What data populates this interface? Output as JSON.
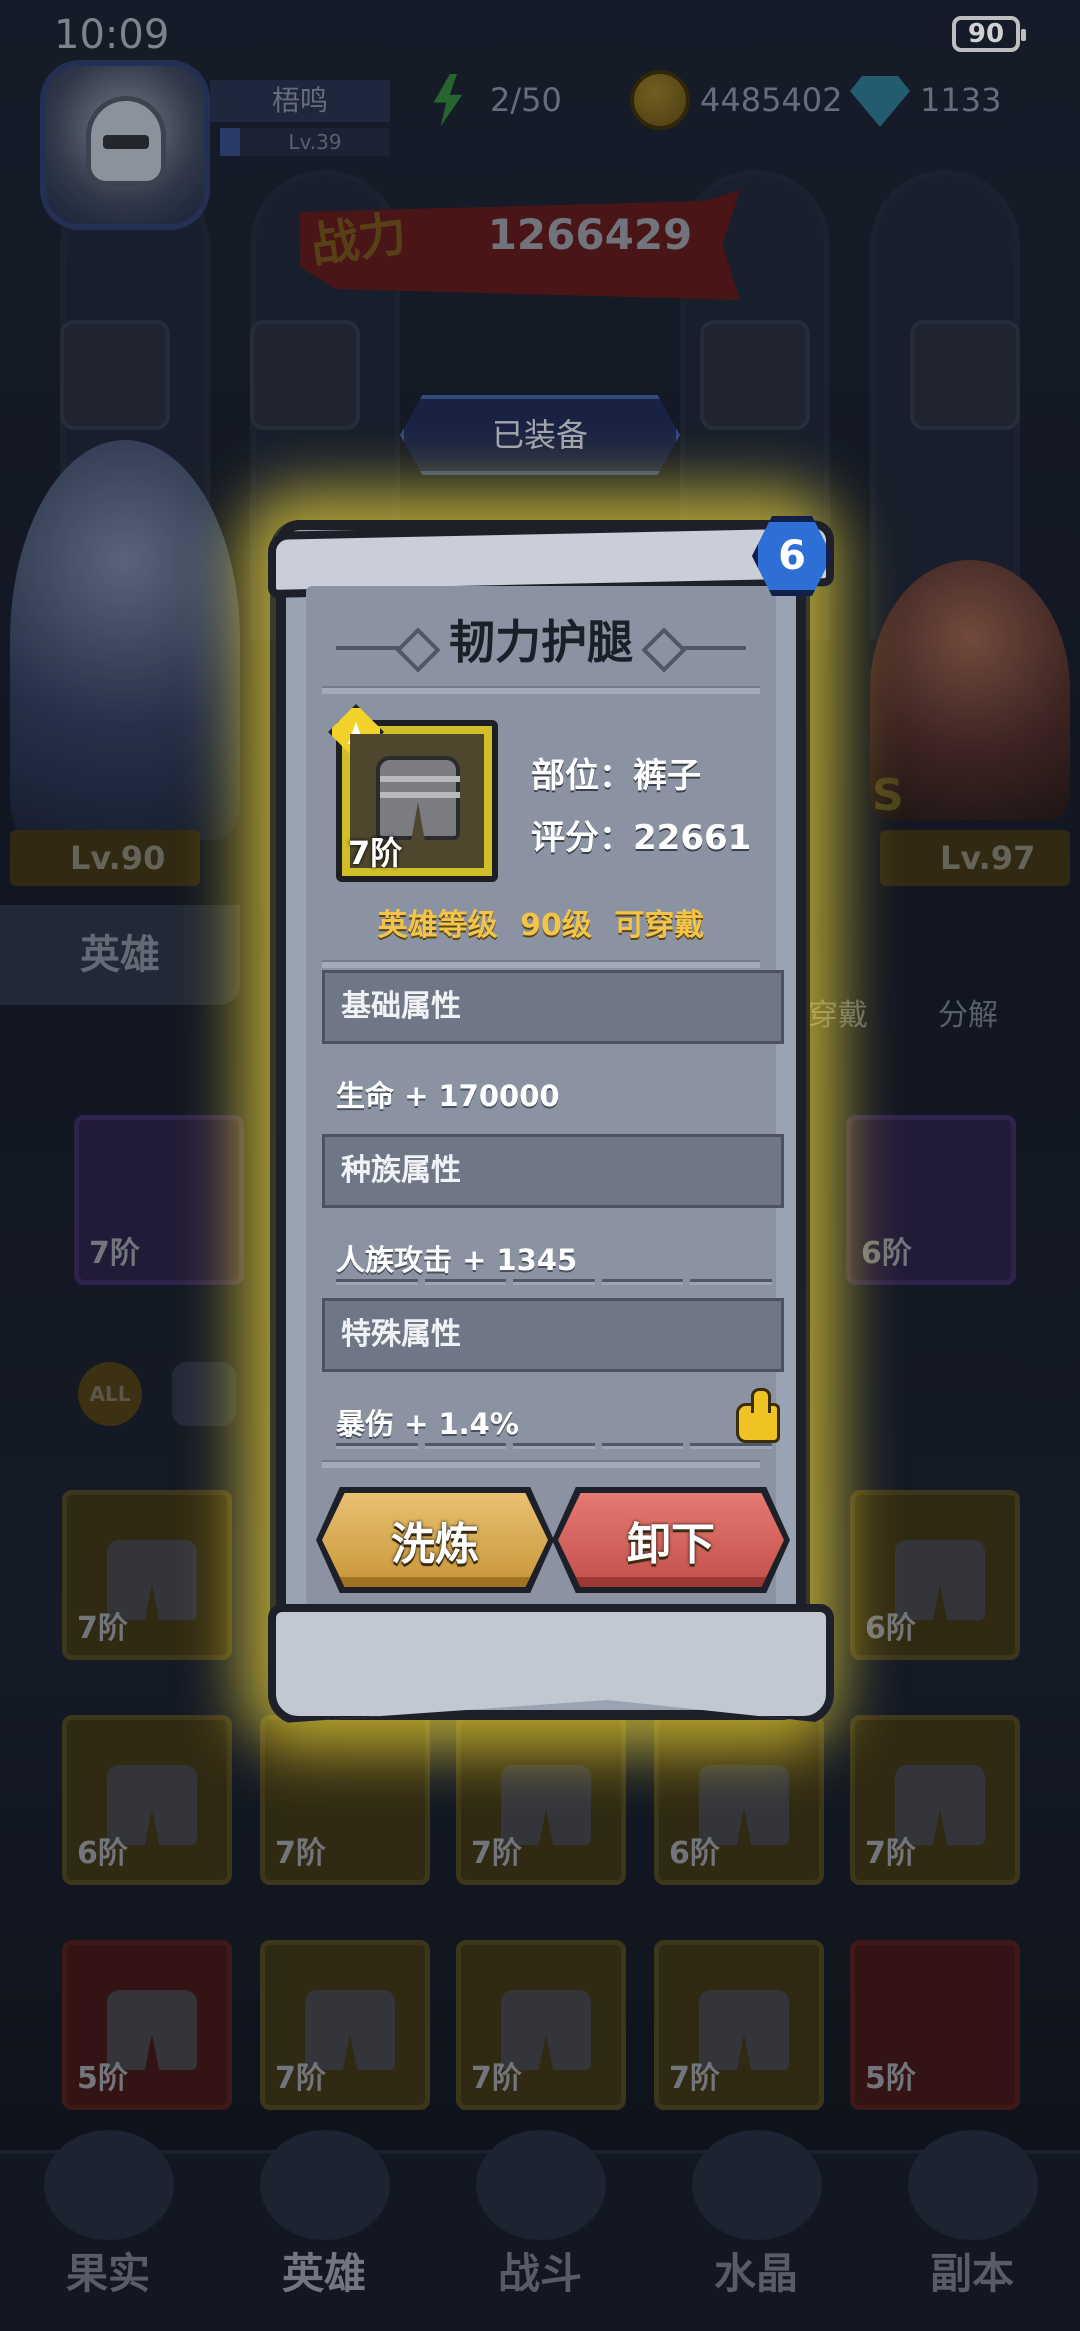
{
  "status_bar": {
    "time": "10:09",
    "battery": "90"
  },
  "player": {
    "name": "梧鸣",
    "level": "Lv.39"
  },
  "resources": {
    "stamina": "2/50",
    "gold": "4485402",
    "gems": "1133"
  },
  "power": {
    "label": "战力",
    "value": "1266429"
  },
  "equipped_tab": "已装备",
  "heroes": {
    "left_level": "Lv.90",
    "right_level": "Lv.97",
    "right_grade": "S"
  },
  "side_tabs": {
    "hero_tab": "英雄",
    "wear_label": "穿戴",
    "decompose_label": "分解"
  },
  "equipped_slots": [
    {
      "tier": "7阶",
      "rarity": "purple"
    },
    {
      "tier": "6阶",
      "rarity": "purple"
    }
  ],
  "filters": {
    "all": "ALL"
  },
  "inventory": [
    {
      "tier": "7阶",
      "rarity": "gold"
    },
    {
      "tier": "6阶",
      "rarity": "gold"
    },
    {
      "tier": "6阶",
      "rarity": "gold"
    },
    {
      "tier": "7阶",
      "rarity": "gold"
    },
    {
      "tier": "7阶",
      "rarity": "gold"
    },
    {
      "tier": "6阶",
      "rarity": "gold"
    },
    {
      "tier": "7阶",
      "rarity": "gold"
    },
    {
      "tier": "5阶",
      "rarity": "red"
    },
    {
      "tier": "7阶",
      "rarity": "gold"
    },
    {
      "tier": "7阶",
      "rarity": "gold"
    },
    {
      "tier": "7阶",
      "rarity": "gold"
    },
    {
      "tier": "5阶",
      "rarity": "red"
    }
  ],
  "bottom_nav": [
    "果实",
    "英雄",
    "战斗",
    "水晶",
    "副本"
  ],
  "modal": {
    "title": "韧力护腿",
    "lock_level": "6",
    "item_tier": "7阶",
    "slot_text": "部位：裤子",
    "score_text": "评分：22661",
    "requirement": {
      "hero_level": "英雄等级",
      "level": "90级",
      "wearable": "可穿戴"
    },
    "sections": {
      "base": "基础属性",
      "race": "种族属性",
      "special": "特殊属性"
    },
    "attributes": {
      "base": "生命 + 170000",
      "race": "人族攻击 + 1345",
      "special": "暴伤 + 1.4%"
    },
    "buttons": {
      "refine": "洗炼",
      "unequip": "卸下"
    }
  },
  "colors": {
    "glow": "#ffe63c",
    "item_frame": "#d1bf2a",
    "requirement_text": "#f3c44a",
    "refine_button": "#d9ad55",
    "unequip_button": "#d4625d",
    "lock_badge": "#2e6fd6"
  },
  "icons": {
    "stamina": "lightning-icon",
    "gold": "coin-icon",
    "gems": "diamond-icon",
    "attribute_badge": "thumbs-up-icon",
    "lock_badge": "lock-icon"
  }
}
